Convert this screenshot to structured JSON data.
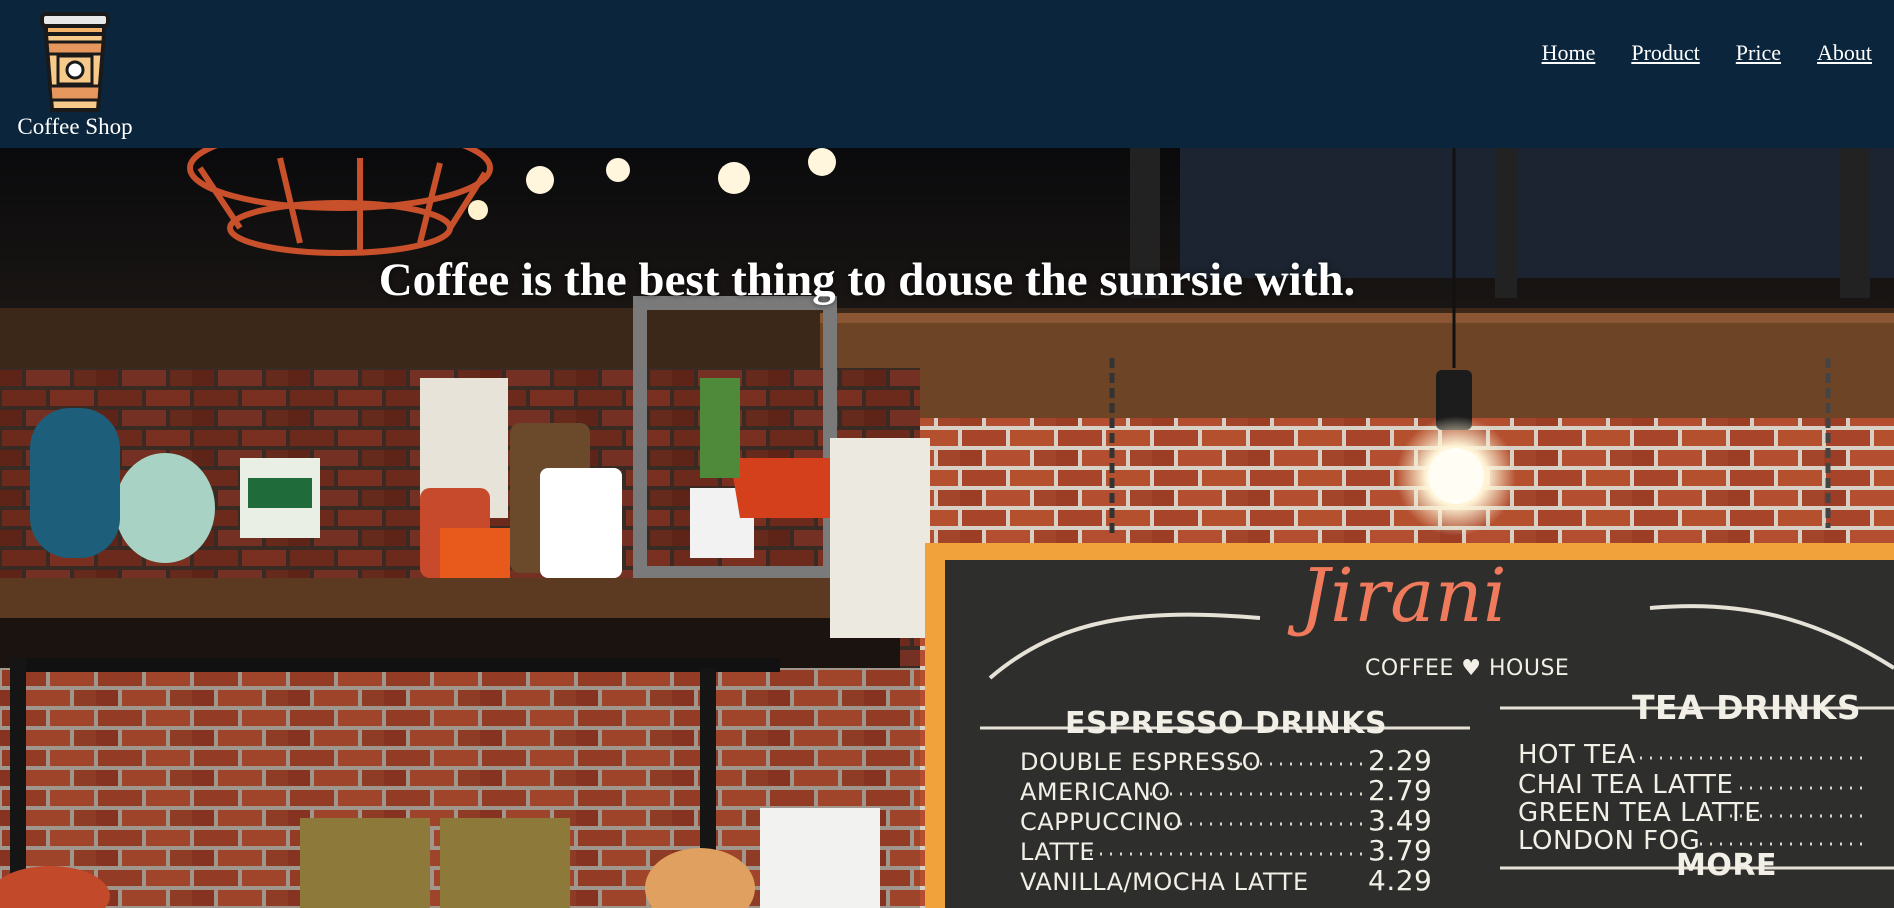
{
  "header": {
    "brand_name": "Coffee Shop",
    "logo_icon": "coffee-cup-icon",
    "background_color": "#0b263c"
  },
  "nav": {
    "items": [
      {
        "label": "Home"
      },
      {
        "label": "Product"
      },
      {
        "label": "Price"
      },
      {
        "label": "About"
      }
    ]
  },
  "hero": {
    "title": "Coffee is the best thing to douse the sunrsie with.",
    "image_alt": "coffee shop interior with chalkboard menu"
  },
  "menu_board": {
    "brand_script": "Jirani",
    "subtitle": "COFFEE ♥ HOUSE",
    "espresso_heading": "ESPRESSO DRINKS",
    "tea_heading": "TEA DRINKS",
    "more_heading": "MORE",
    "espresso_items": [
      {
        "name": "DOUBLE ESPRESSO",
        "price": "2.29"
      },
      {
        "name": "AMERICANO",
        "price": "2.79"
      },
      {
        "name": "CAPPUCCINO",
        "price": "3.49"
      },
      {
        "name": "LATTE",
        "price": "3.79"
      },
      {
        "name": "VANILLA/MOCHA LATTE",
        "price": "4.29"
      }
    ],
    "tea_items": [
      {
        "name": "HOT TEA"
      },
      {
        "name": "CHAI TEA LATTE"
      },
      {
        "name": "GREEN TEA LATTE"
      },
      {
        "name": "LONDON FOG"
      }
    ]
  }
}
